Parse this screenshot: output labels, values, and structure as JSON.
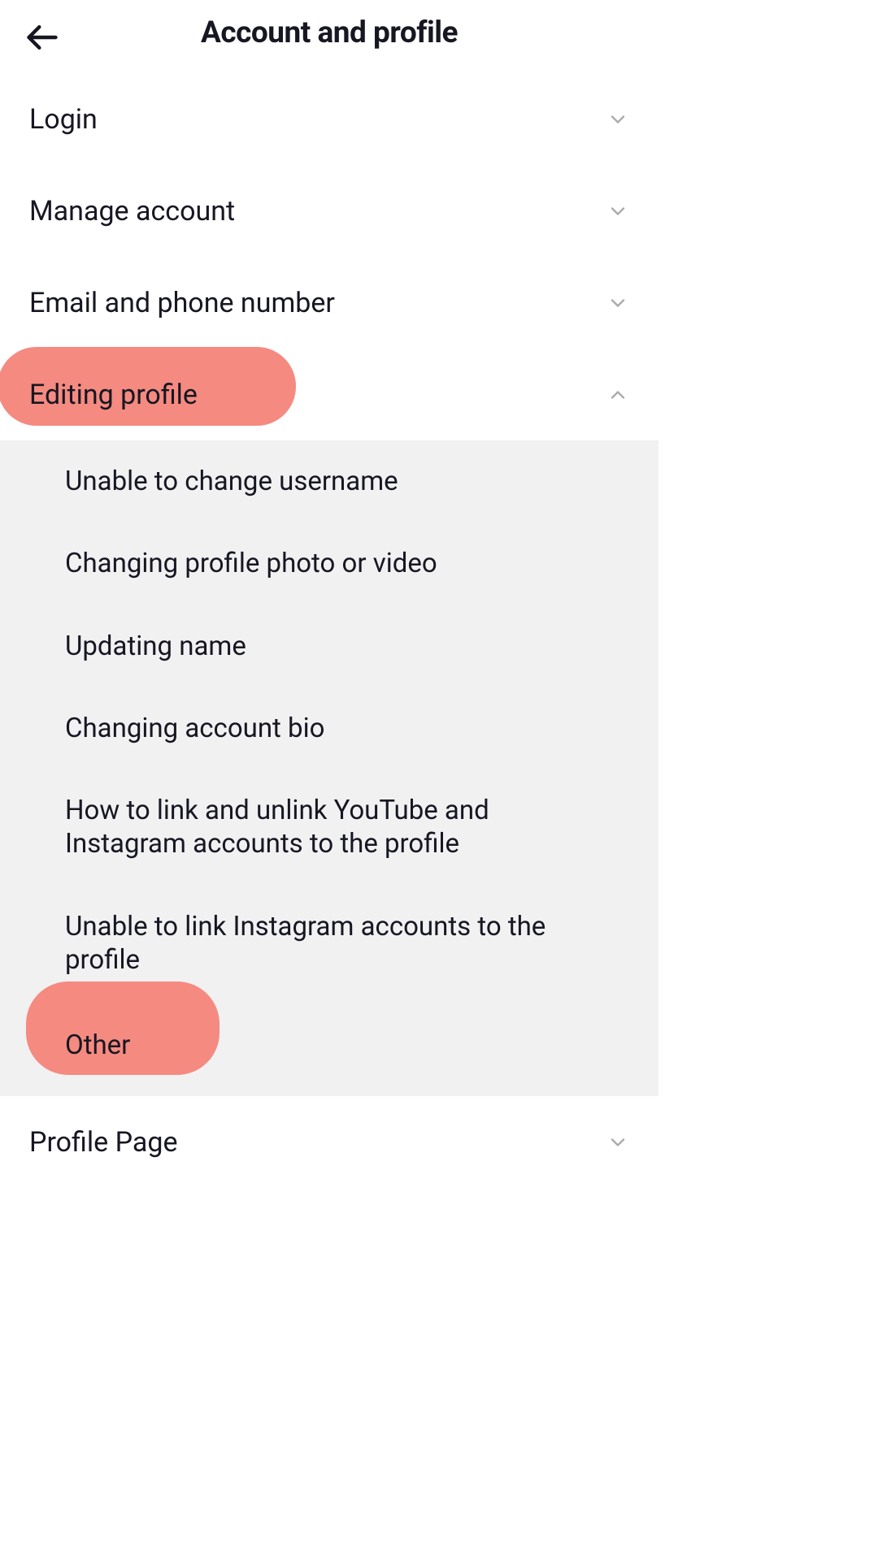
{
  "header": {
    "title": "Account and profile"
  },
  "sections": {
    "login": "Login",
    "manage_account": "Manage account",
    "email_phone": "Email and phone number",
    "editing_profile": "Editing profile",
    "profile_page": "Profile Page"
  },
  "editing_profile_items": {
    "i0": "Unable to change username",
    "i1": "Changing profile photo or video",
    "i2": "Updating name",
    "i3": "Changing account bio",
    "i4": "How to link and unlink YouTube and Instagram accounts to the profile",
    "i5": "Unable to link Instagram accounts to the profile",
    "i6": "Other"
  }
}
